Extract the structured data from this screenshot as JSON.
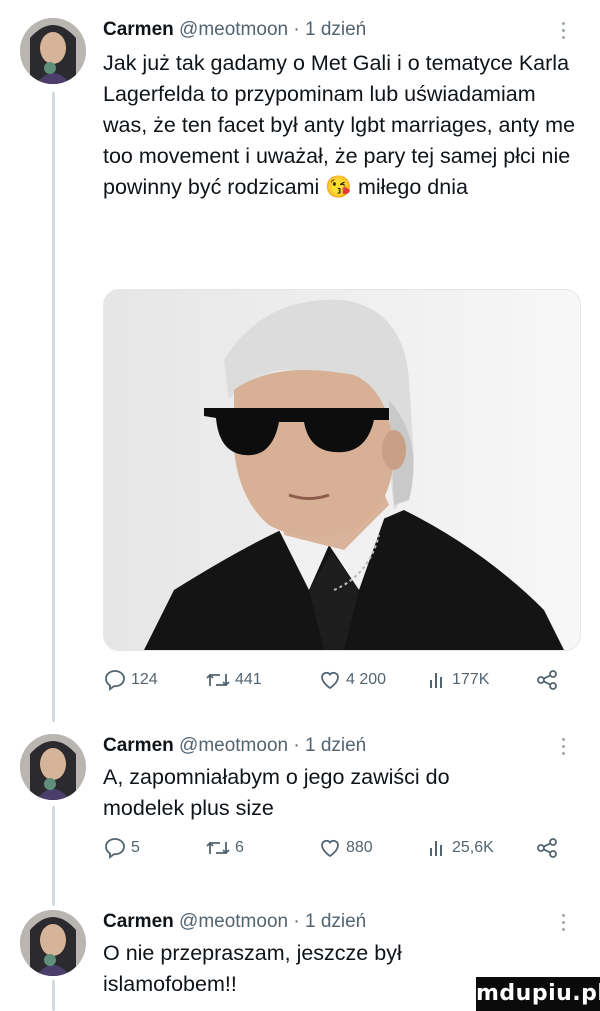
{
  "tweets": [
    {
      "name": "Carmen",
      "handle": "@meotmoon",
      "time": "· 1 dzień",
      "text": "Jak już tak gadamy o Met Gali i o tematyce Karla Lagerfelda to przypominam lub uświadamiam was, że ten facet był anty lgbt marriages, anty me too movement i uważał, że pary tej samej płci nie powinny być rodzicami 😘 miłego dnia",
      "has_image": true,
      "image_icon": "photo-of-man-in-sunglasses",
      "actions": {
        "replies": "124",
        "reposts": "441",
        "likes": "4 200",
        "views": "177K"
      }
    },
    {
      "name": "Carmen",
      "handle": "@meotmoon",
      "time": "· 1 dzień",
      "text": "A, zapomniałabym o jego zawiści do modelek plus size",
      "actions": {
        "replies": "5",
        "reposts": "6",
        "likes": "880",
        "views": "25,6K"
      }
    },
    {
      "name": "Carmen",
      "handle": "@meotmoon",
      "time": "· 1 dzień",
      "text": "O nie przepraszam, jeszcze był islamofobem!!"
    }
  ],
  "icons": {
    "reply": "reply-icon",
    "repost": "repost-icon",
    "like": "heart-icon",
    "views": "views-icon",
    "share": "share-icon",
    "more": "more-options-icon"
  },
  "watermark": "mdupiu.pl",
  "colors": {
    "text": "#0f1419",
    "muted": "#536471",
    "thread": "#cfd9de",
    "watermark_bg": "#0b0b0b"
  }
}
